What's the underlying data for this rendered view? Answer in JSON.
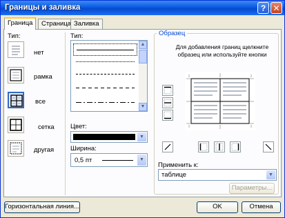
{
  "window": {
    "title": "Границы и заливка",
    "help_label": "?",
    "close_label": "✕"
  },
  "tabs": [
    {
      "label": "Граница"
    },
    {
      "label": "Страница"
    },
    {
      "label": "Заливка"
    }
  ],
  "type_section": {
    "label": "Тип:",
    "presets": [
      {
        "label": "нет"
      },
      {
        "label": "рамка"
      },
      {
        "label": "все"
      },
      {
        "label": "сетка"
      },
      {
        "label": "другая"
      }
    ],
    "selected_preset": "все"
  },
  "style_section": {
    "label": "Тип:",
    "line_styles": [
      "solid",
      "dotted",
      "dashed-small",
      "dashed",
      "dash-dot"
    ],
    "selected_style": "solid"
  },
  "color": {
    "label": "Цвет:",
    "value": "#000000"
  },
  "width": {
    "label": "Ширина:",
    "value": "0,5 пт"
  },
  "preview": {
    "label": "Образец",
    "hint": "Для добавления границ щелкните образец или используйте кнопки"
  },
  "apply_to": {
    "label": "Применить к:",
    "value": "таблице"
  },
  "buttons": {
    "options": "Параметры...",
    "horizontal_line": "Горизонтальная линия...",
    "ok": "OK",
    "cancel": "Отмена"
  }
}
